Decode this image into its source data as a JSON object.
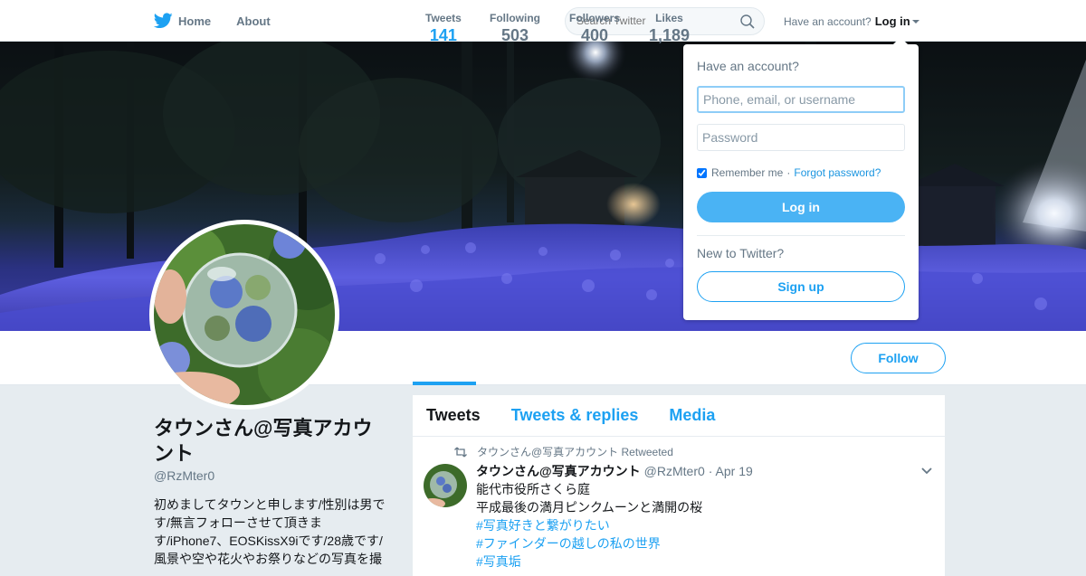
{
  "nav": {
    "home_label": "Home",
    "about_label": "About",
    "search_placeholder": "Search Twitter",
    "account_prompt": "Have an account?",
    "login_label": "Log in"
  },
  "icons": {
    "logo": "twitter-bird-icon",
    "search": "search-icon",
    "caret": "caret-down-icon",
    "retweet": "retweet-icon",
    "tweet_menu": "chevron-down-icon"
  },
  "colors": {
    "accent": "#1da1f2",
    "login_button": "#4ab3f4",
    "background": "#e6ecf0"
  },
  "profile": {
    "name": "タウンさん@写真アカウント",
    "handle": "@RzMter0",
    "bio": "初めましてタウンと申します/性別は男です/無言フォローさせて頂きます/iPhone7、EOSKissX9iです/28歳です/風景や空や花火やお祭りなどの写真を撮"
  },
  "stats": [
    {
      "label": "Tweets",
      "value": "141"
    },
    {
      "label": "Following",
      "value": "503"
    },
    {
      "label": "Followers",
      "value": "400"
    },
    {
      "label": "Likes",
      "value": "1,189"
    }
  ],
  "follow_label": "Follow",
  "timeline": {
    "tabs": [
      "Tweets",
      "Tweets & replies",
      "Media"
    ],
    "tweet": {
      "retweeted_by": "タウンさん@写真アカウント Retweeted",
      "fullname": "タウンさん@写真アカウント",
      "username": "@RzMter0",
      "time": "· Apr 19",
      "lines": [
        "能代市役所さくら庭",
        "平成最後の満月ピンクムーンと満開の桜"
      ],
      "hashtags": [
        "#写真好きと繋がりたい",
        "#ファインダーの越しの私の世界",
        "#写真垢"
      ]
    }
  },
  "login_dropdown": {
    "title": "Have an account?",
    "username_placeholder": "Phone, email, or username",
    "password_placeholder": "Password",
    "remember_label": "Remember me",
    "separator": "·",
    "forgot_label": "Forgot password?",
    "login_button": "Log in",
    "new_prompt": "New to Twitter?",
    "signup_button": "Sign up"
  }
}
